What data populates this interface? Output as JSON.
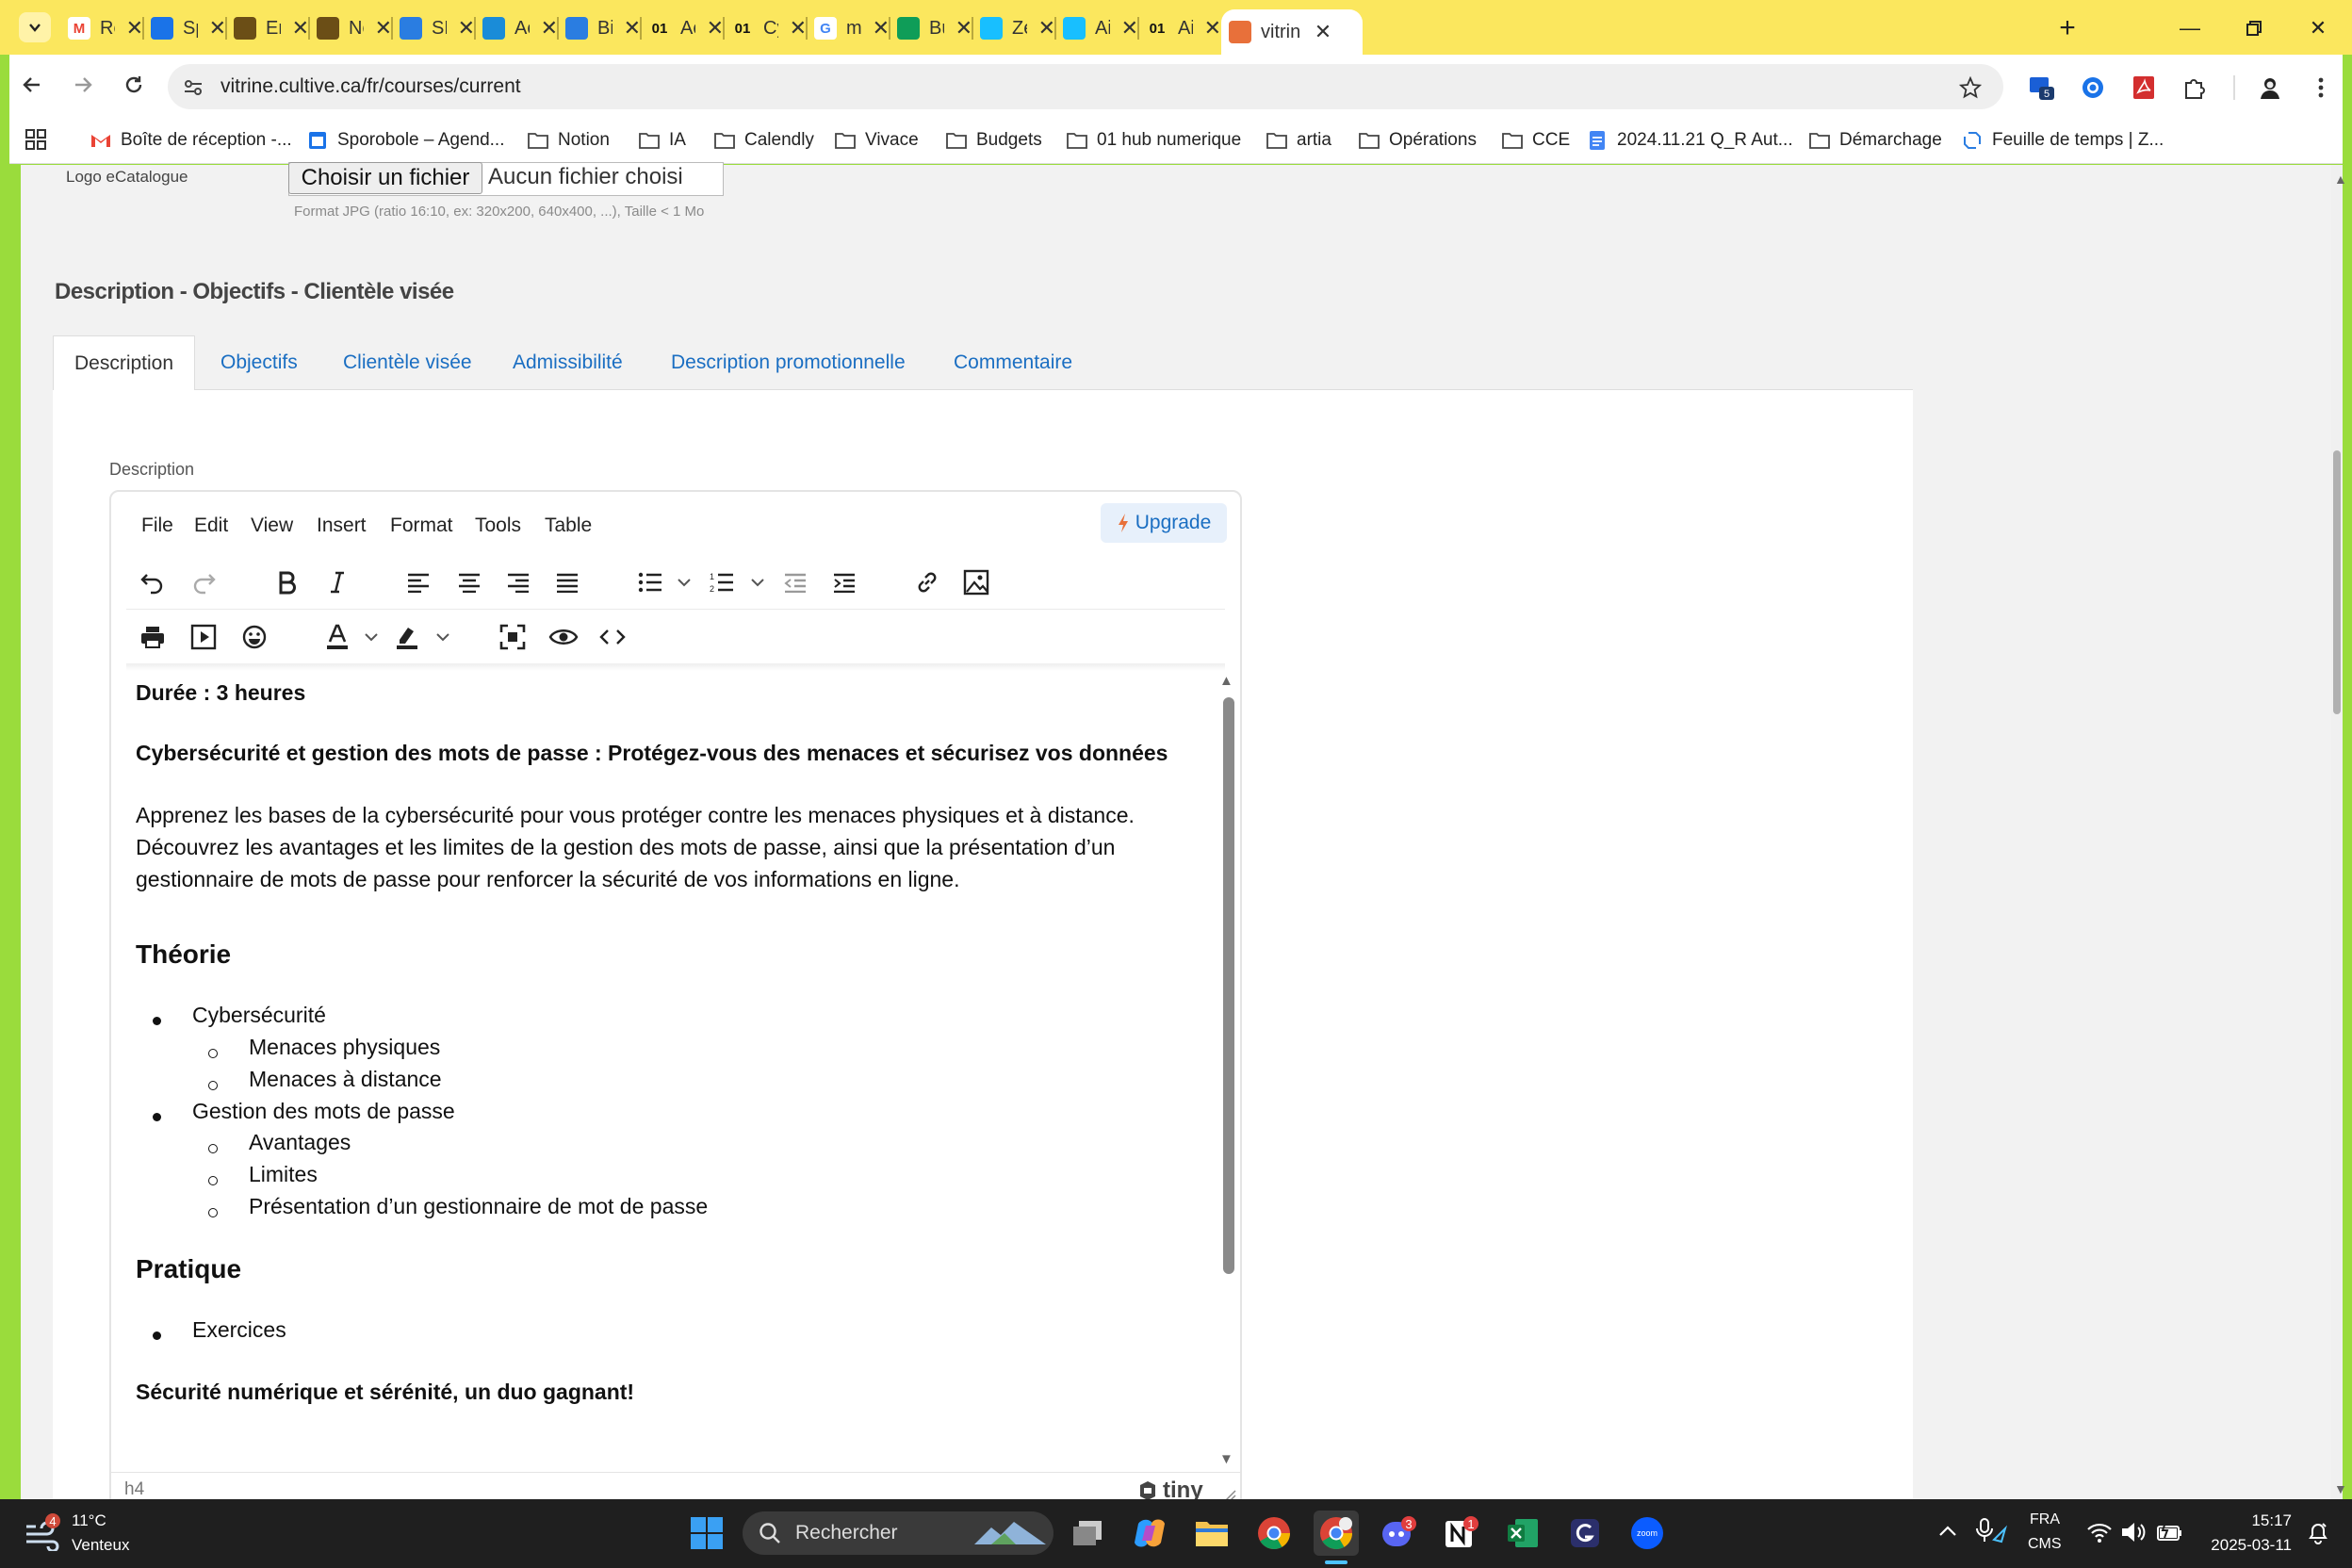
{
  "browser": {
    "tabs": [
      {
        "label": "Re: r",
        "icon": "gmail-icon",
        "color": "#ea4335"
      },
      {
        "label": "Spo",
        "icon": "calendar-icon",
        "color": "#1a73e8"
      },
      {
        "label": "Ente",
        "icon": "folder-icon",
        "color": "#6b4e16"
      },
      {
        "label": "Nou",
        "icon": "folder-icon",
        "color": "#6b4e16"
      },
      {
        "label": "SPO",
        "icon": "link-icon",
        "color": "#2a7de1"
      },
      {
        "label": "Accu",
        "icon": "cultive-icon",
        "color": "#1a8cd8"
      },
      {
        "label": "Bien",
        "icon": "link-icon",
        "color": "#2a7de1"
      },
      {
        "label": "Accu",
        "icon": "01net-icon",
        "color": "#111"
      },
      {
        "label": "Cybe",
        "icon": "01net-icon",
        "color": "#111"
      },
      {
        "label": "mon",
        "icon": "google-icon",
        "color": "#4285f4"
      },
      {
        "label": "Bud",
        "icon": "sheets-icon",
        "color": "#0f9d58"
      },
      {
        "label": "Zeff",
        "icon": "airtable-icon",
        "color": "#18bfff"
      },
      {
        "label": "Airta",
        "icon": "airtable-icon",
        "color": "#18bfff"
      },
      {
        "label": "Airta",
        "icon": "01net-icon",
        "color": "#111"
      },
      {
        "label": "vitrin",
        "icon": "vitrine-icon",
        "color": "#e8703a",
        "active": true
      }
    ],
    "url": "vitrine.cultive.ca/fr/courses/current",
    "bookmarks": [
      {
        "label": "Boîte de réception -...",
        "icon": "gmail-icon"
      },
      {
        "label": "Sporobole – Agend...",
        "icon": "calendar-icon"
      },
      {
        "label": "Notion",
        "icon": "folder-icon"
      },
      {
        "label": "IA",
        "icon": "folder-icon"
      },
      {
        "label": "Calendly",
        "icon": "folder-icon"
      },
      {
        "label": "Vivace",
        "icon": "folder-icon"
      },
      {
        "label": "Budgets",
        "icon": "folder-icon"
      },
      {
        "label": "01 hub numerique",
        "icon": "folder-icon"
      },
      {
        "label": "artia",
        "icon": "folder-icon"
      },
      {
        "label": "Opérations",
        "icon": "folder-icon"
      },
      {
        "label": "CCE",
        "icon": "folder-icon"
      },
      {
        "label": "2024.11.21 Q_R Aut...",
        "icon": "docs-icon"
      },
      {
        "label": "Démarchage",
        "icon": "folder-icon"
      },
      {
        "label": "Feuille de temps | Z...",
        "icon": "link-icon"
      }
    ],
    "extension_badge": "5"
  },
  "form": {
    "logo_label": "Logo eCatalogue",
    "file_button": "Choisir un fichier",
    "file_status": "Aucun fichier choisi",
    "file_hint": "Format JPG (ratio 16:10, ex: 320x200, 640x400, ...), Taille < 1 Mo",
    "section_title": "Description - Objectifs - Clientèle visée",
    "tabs": [
      "Description",
      "Objectifs",
      "Clientèle visée",
      "Admissibilité",
      "Description promotionnelle",
      "Commentaire"
    ],
    "field_label": "Description"
  },
  "editor": {
    "menu": [
      "File",
      "Edit",
      "View",
      "Insert",
      "Format",
      "Tools",
      "Table"
    ],
    "upgrade_label": "Upgrade",
    "content": {
      "duration": "Durée : 3 heures",
      "title": "Cybersécurité et gestion des mots de passe : Protégez-vous des menaces et sécurisez vos données",
      "intro": [
        "Apprenez les bases de la cybersécurité pour vous protéger contre les menaces physiques et à distance.",
        "Découvrez les avantages et les limites de la gestion des mots de passe, ainsi que la présentation d’un",
        "gestionnaire de mots de passe pour renforcer la sécurité de vos informations en ligne."
      ],
      "theory_heading": "Théorie",
      "theory": [
        {
          "item": "Cybersécurité",
          "sub": [
            "Menaces physiques",
            "Menaces à distance"
          ]
        },
        {
          "item": "Gestion des mots de passe",
          "sub": [
            "Avantages",
            "Limites",
            "Présentation d’un gestionnaire de mot de passe"
          ]
        }
      ],
      "practice_heading": "Pratique",
      "practice": [
        "Exercices"
      ],
      "closing": "Sécurité numérique et sérénité, un duo gagnant!"
    },
    "status_path": "h4",
    "brand": "tiny"
  },
  "taskbar": {
    "weather_temp": "11°C",
    "weather_desc": "Venteux",
    "weather_badge": "4",
    "search_placeholder": "Rechercher",
    "lang": "FRA",
    "lang_sub": "CMS",
    "time": "15:17",
    "date": "2025-03-11",
    "discord_badge": "3",
    "notion_badge": "1"
  }
}
